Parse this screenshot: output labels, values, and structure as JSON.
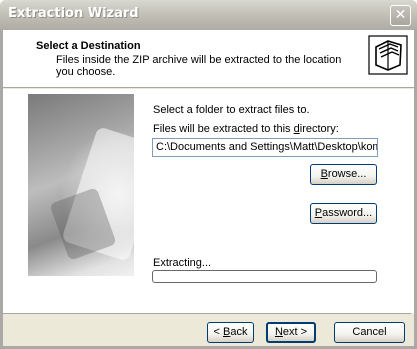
{
  "window": {
    "title": "Extraction Wizard"
  },
  "header": {
    "title": "Select a Destination",
    "description": "Files inside the ZIP archive will be extracted to the location you choose."
  },
  "main": {
    "instruction": "Select a folder to extract files to.",
    "directory_label": "Files will be extracted to this directory:",
    "directory_value": "C:\\Documents and Settings\\Matt\\Desktop\\kompoz",
    "browse_label": "Browse...",
    "password_label": "Password...",
    "extracting_label": "Extracting...",
    "progress_fraction": 0
  },
  "footer": {
    "back_label": "< Back",
    "next_label": "Next >",
    "cancel_label": "Cancel"
  },
  "icons": {
    "header_icon": "folders-icon",
    "close": "close-icon"
  }
}
